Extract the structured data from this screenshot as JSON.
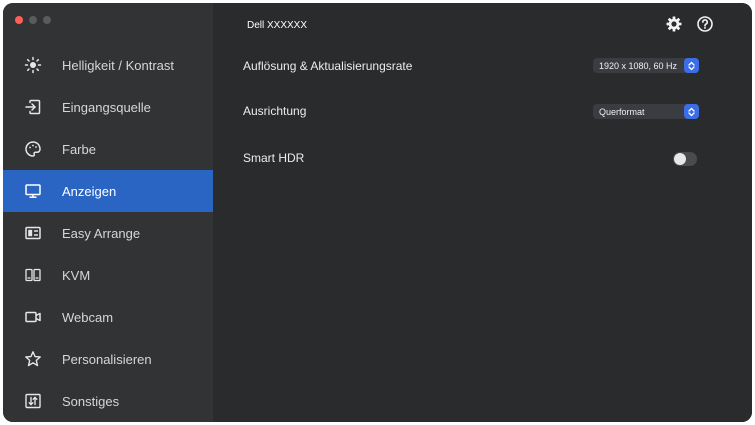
{
  "window": {
    "title": "Dell XXXXXX"
  },
  "traffic_lights": {
    "colors": [
      "#ff5f57",
      "#5a5b5e",
      "#5a5b5e"
    ]
  },
  "sidebar": {
    "items": [
      {
        "label": "Helligkeit / Kontrast",
        "icon": "sun-icon",
        "active": false
      },
      {
        "label": "Eingangsquelle",
        "icon": "input-source-icon",
        "active": false
      },
      {
        "label": "Farbe",
        "icon": "palette-icon",
        "active": false
      },
      {
        "label": "Anzeigen",
        "icon": "monitor-icon",
        "active": true
      },
      {
        "label": "Easy Arrange",
        "icon": "layout-icon",
        "active": false
      },
      {
        "label": "KVM",
        "icon": "kvm-icon",
        "active": false
      },
      {
        "label": "Webcam",
        "icon": "webcam-icon",
        "active": false
      },
      {
        "label": "Personalisieren",
        "icon": "star-icon",
        "active": false
      },
      {
        "label": "Sonstiges",
        "icon": "sort-icon",
        "active": false
      }
    ]
  },
  "toolbar": {
    "settings_icon": "gear-icon",
    "help_icon": "help-icon"
  },
  "settings": {
    "resolution": {
      "label": "Auflösung & Aktualisierungsrate",
      "value": "1920 x 1080, 60 Hz"
    },
    "orientation": {
      "label": "Ausrichtung",
      "value": "Querformat"
    },
    "smart_hdr": {
      "label": "Smart HDR",
      "enabled": false
    }
  },
  "colors": {
    "accent": "#2a65c4",
    "select_chevron": "#3b6ee6",
    "sidebar_bg": "#323335",
    "main_bg": "#2a2b2d"
  }
}
